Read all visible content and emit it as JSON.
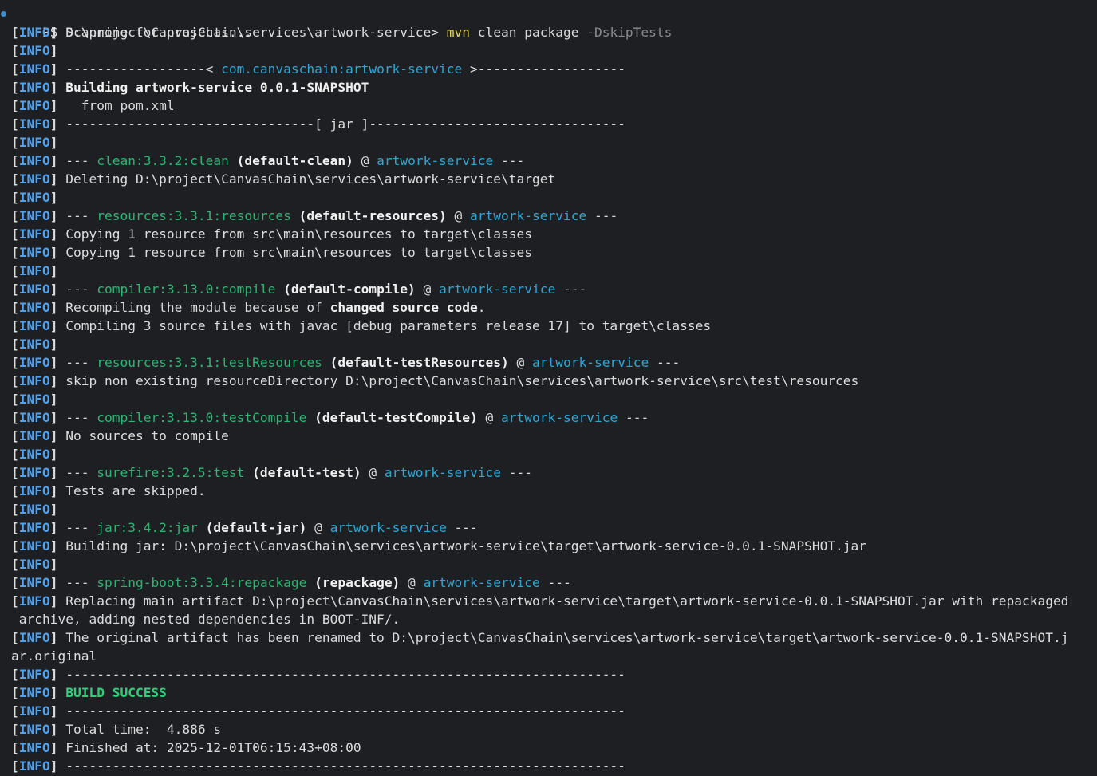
{
  "terminal": {
    "prompt": "PS D:\\project\\CanvasChain\\services\\artwork-service> ",
    "command": "mvn",
    "args": " clean package ",
    "flag": "-DskipTests",
    "colors": {
      "background": "#1e1f22",
      "info_tag": "#4ea3f2",
      "plugin": "#2bb673",
      "artifact": "#29a8d8",
      "success": "#2ed17a",
      "command": "#e5d35a",
      "flag": "#8b8b8b"
    },
    "lines": [
      {
        "tag": true,
        "segments": [
          {
            "text": "Scanning for projects...",
            "style": "default"
          }
        ]
      },
      {
        "tag": true,
        "segments": []
      },
      {
        "tag": true,
        "segments": [
          {
            "text": "------------------< ",
            "style": "default"
          },
          {
            "text": "com.canvaschain:artwork-service",
            "style": "artifact"
          },
          {
            "text": " >-------------------",
            "style": "default"
          }
        ]
      },
      {
        "tag": true,
        "segments": [
          {
            "text": "Building artwork-service 0.0.1-SNAPSHOT",
            "style": "bold"
          }
        ]
      },
      {
        "tag": true,
        "segments": [
          {
            "text": "  from pom.xml",
            "style": "default"
          }
        ]
      },
      {
        "tag": true,
        "segments": [
          {
            "text": "--------------------------------[ jar ]---------------------------------",
            "style": "default"
          }
        ]
      },
      {
        "tag": true,
        "segments": []
      },
      {
        "tag": true,
        "segments": [
          {
            "text": "--- ",
            "style": "default"
          },
          {
            "text": "clean:3.3.2:clean",
            "style": "plugin"
          },
          {
            "text": " (default-clean)",
            "style": "bold"
          },
          {
            "text": " @ ",
            "style": "default"
          },
          {
            "text": "artwork-service",
            "style": "artifact"
          },
          {
            "text": " ---",
            "style": "default"
          }
        ]
      },
      {
        "tag": true,
        "segments": [
          {
            "text": "Deleting D:\\project\\CanvasChain\\services\\artwork-service\\target",
            "style": "default"
          }
        ]
      },
      {
        "tag": true,
        "segments": []
      },
      {
        "tag": true,
        "segments": [
          {
            "text": "--- ",
            "style": "default"
          },
          {
            "text": "resources:3.3.1:resources",
            "style": "plugin"
          },
          {
            "text": " (default-resources)",
            "style": "bold"
          },
          {
            "text": " @ ",
            "style": "default"
          },
          {
            "text": "artwork-service",
            "style": "artifact"
          },
          {
            "text": " ---",
            "style": "default"
          }
        ]
      },
      {
        "tag": true,
        "segments": [
          {
            "text": "Copying 1 resource from src\\main\\resources to target\\classes",
            "style": "default"
          }
        ]
      },
      {
        "tag": true,
        "segments": [
          {
            "text": "Copying 1 resource from src\\main\\resources to target\\classes",
            "style": "default"
          }
        ]
      },
      {
        "tag": true,
        "segments": []
      },
      {
        "tag": true,
        "segments": [
          {
            "text": "--- ",
            "style": "default"
          },
          {
            "text": "compiler:3.13.0:compile",
            "style": "plugin"
          },
          {
            "text": " (default-compile)",
            "style": "bold"
          },
          {
            "text": " @ ",
            "style": "default"
          },
          {
            "text": "artwork-service",
            "style": "artifact"
          },
          {
            "text": " ---",
            "style": "default"
          }
        ]
      },
      {
        "tag": true,
        "segments": [
          {
            "text": "Recompiling the module because of ",
            "style": "default"
          },
          {
            "text": "changed source code",
            "style": "bold"
          },
          {
            "text": ".",
            "style": "default"
          }
        ]
      },
      {
        "tag": true,
        "segments": [
          {
            "text": "Compiling 3 source files with javac [debug parameters release 17] to target\\classes",
            "style": "default"
          }
        ]
      },
      {
        "tag": true,
        "segments": []
      },
      {
        "tag": true,
        "segments": [
          {
            "text": "--- ",
            "style": "default"
          },
          {
            "text": "resources:3.3.1:testResources",
            "style": "plugin"
          },
          {
            "text": " (default-testResources)",
            "style": "bold"
          },
          {
            "text": " @ ",
            "style": "default"
          },
          {
            "text": "artwork-service",
            "style": "artifact"
          },
          {
            "text": " ---",
            "style": "default"
          }
        ]
      },
      {
        "tag": true,
        "segments": [
          {
            "text": "skip non existing resourceDirectory D:\\project\\CanvasChain\\services\\artwork-service\\src\\test\\resources",
            "style": "default"
          }
        ]
      },
      {
        "tag": true,
        "segments": []
      },
      {
        "tag": true,
        "segments": [
          {
            "text": "--- ",
            "style": "default"
          },
          {
            "text": "compiler:3.13.0:testCompile",
            "style": "plugin"
          },
          {
            "text": " (default-testCompile)",
            "style": "bold"
          },
          {
            "text": " @ ",
            "style": "default"
          },
          {
            "text": "artwork-service",
            "style": "artifact"
          },
          {
            "text": " ---",
            "style": "default"
          }
        ]
      },
      {
        "tag": true,
        "segments": [
          {
            "text": "No sources to compile",
            "style": "default"
          }
        ]
      },
      {
        "tag": true,
        "segments": []
      },
      {
        "tag": true,
        "segments": [
          {
            "text": "--- ",
            "style": "default"
          },
          {
            "text": "surefire:3.2.5:test",
            "style": "plugin"
          },
          {
            "text": " (default-test)",
            "style": "bold"
          },
          {
            "text": " @ ",
            "style": "default"
          },
          {
            "text": "artwork-service",
            "style": "artifact"
          },
          {
            "text": " ---",
            "style": "default"
          }
        ]
      },
      {
        "tag": true,
        "segments": [
          {
            "text": "Tests are skipped.",
            "style": "default"
          }
        ]
      },
      {
        "tag": true,
        "segments": []
      },
      {
        "tag": true,
        "segments": [
          {
            "text": "--- ",
            "style": "default"
          },
          {
            "text": "jar:3.4.2:jar",
            "style": "plugin"
          },
          {
            "text": " (default-jar)",
            "style": "bold"
          },
          {
            "text": " @ ",
            "style": "default"
          },
          {
            "text": "artwork-service",
            "style": "artifact"
          },
          {
            "text": " ---",
            "style": "default"
          }
        ]
      },
      {
        "tag": true,
        "segments": [
          {
            "text": "Building jar: D:\\project\\CanvasChain\\services\\artwork-service\\target\\artwork-service-0.0.1-SNAPSHOT.jar",
            "style": "default"
          }
        ]
      },
      {
        "tag": true,
        "segments": []
      },
      {
        "tag": true,
        "segments": [
          {
            "text": "--- ",
            "style": "default"
          },
          {
            "text": "spring-boot:3.3.4:repackage",
            "style": "plugin"
          },
          {
            "text": " (repackage)",
            "style": "bold"
          },
          {
            "text": " @ ",
            "style": "default"
          },
          {
            "text": "artwork-service",
            "style": "artifact"
          },
          {
            "text": " ---",
            "style": "default"
          }
        ]
      },
      {
        "tag": true,
        "segments": [
          {
            "text": "Replacing main artifact D:\\project\\CanvasChain\\services\\artwork-service\\target\\artwork-service-0.0.1-SNAPSHOT.jar with repackaged",
            "style": "default"
          }
        ]
      },
      {
        "tag": false,
        "segments": [
          {
            "text": " archive, adding nested dependencies in BOOT-INF/.",
            "style": "default"
          }
        ]
      },
      {
        "tag": true,
        "segments": [
          {
            "text": "The original artifact has been renamed to D:\\project\\CanvasChain\\services\\artwork-service\\target\\artwork-service-0.0.1-SNAPSHOT.j",
            "style": "default"
          }
        ]
      },
      {
        "tag": false,
        "segments": [
          {
            "text": "ar.original",
            "style": "default"
          }
        ]
      },
      {
        "tag": true,
        "segments": [
          {
            "text": "------------------------------------------------------------------------",
            "style": "default"
          }
        ]
      },
      {
        "tag": true,
        "segments": [
          {
            "text": "BUILD SUCCESS",
            "style": "success"
          }
        ]
      },
      {
        "tag": true,
        "segments": [
          {
            "text": "------------------------------------------------------------------------",
            "style": "default"
          }
        ]
      },
      {
        "tag": true,
        "segments": [
          {
            "text": "Total time:  4.886 s",
            "style": "default"
          }
        ]
      },
      {
        "tag": true,
        "segments": [
          {
            "text": "Finished at: 2025-12-01T06:15:43+08:00",
            "style": "default"
          }
        ]
      },
      {
        "tag": true,
        "segments": [
          {
            "text": "------------------------------------------------------------------------",
            "style": "default"
          }
        ]
      }
    ],
    "info_open": "[",
    "info_label": "INFO",
    "info_close": "] "
  }
}
